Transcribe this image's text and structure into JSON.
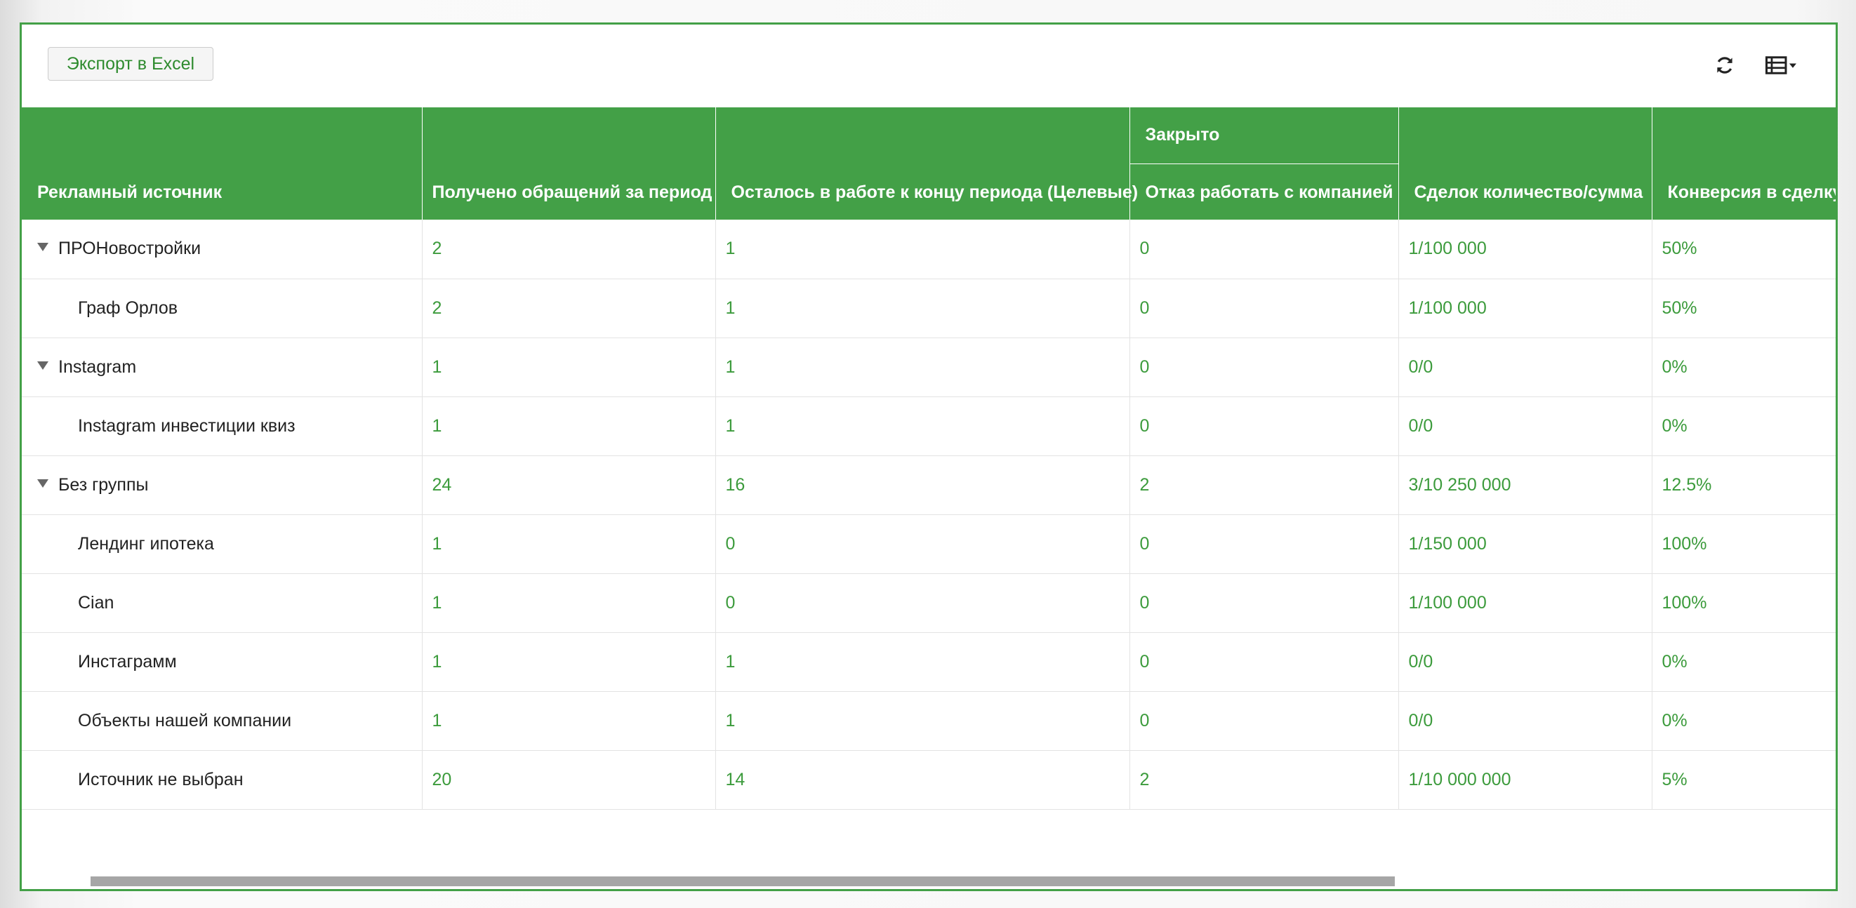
{
  "toolbar": {
    "export_label": "Экспорт в Excel",
    "refresh_icon": "refresh-icon",
    "columns_icon": "table-columns-dropdown-icon"
  },
  "colors": {
    "accent": "#43a047",
    "value_text": "#3c9b3c"
  },
  "table": {
    "headers": {
      "source": "Рекламный источник",
      "received": "Получено обращений за период",
      "remaining": "Осталось в работе к концу периода (Целевые)",
      "closed_group": "Закрыто",
      "refused": "Отказ работать с компанией",
      "deals": "Сделок количество/сумма",
      "conversion": "Конверсия в сделку"
    },
    "rows": [
      {
        "source": "ПРОНовостройки",
        "group": true,
        "received": "2",
        "remaining": "1",
        "refused": "0",
        "deals": "1/100 000",
        "conversion": "50%"
      },
      {
        "source": "Граф Орлов",
        "group": false,
        "received": "2",
        "remaining": "1",
        "refused": "0",
        "deals": "1/100 000",
        "conversion": "50%"
      },
      {
        "source": "Instagram",
        "group": true,
        "received": "1",
        "remaining": "1",
        "refused": "0",
        "deals": "0/0",
        "conversion": "0%"
      },
      {
        "source": "Instagram инвестиции квиз",
        "group": false,
        "received": "1",
        "remaining": "1",
        "refused": "0",
        "deals": "0/0",
        "conversion": "0%"
      },
      {
        "source": "Без группы",
        "group": true,
        "received": "24",
        "remaining": "16",
        "refused": "2",
        "deals": "3/10 250 000",
        "conversion": "12.5%"
      },
      {
        "source": "Лендинг ипотека",
        "group": false,
        "received": "1",
        "remaining": "0",
        "refused": "0",
        "deals": "1/150 000",
        "conversion": "100%"
      },
      {
        "source": "Cian",
        "group": false,
        "received": "1",
        "remaining": "0",
        "refused": "0",
        "deals": "1/100 000",
        "conversion": "100%"
      },
      {
        "source": "Инстаграмм",
        "group": false,
        "received": "1",
        "remaining": "1",
        "refused": "0",
        "deals": "0/0",
        "conversion": "0%"
      },
      {
        "source": "Объекты нашей компании",
        "group": false,
        "received": "1",
        "remaining": "1",
        "refused": "0",
        "deals": "0/0",
        "conversion": "0%"
      },
      {
        "source": "Источник не выбран",
        "group": false,
        "received": "20",
        "remaining": "14",
        "refused": "2",
        "deals": "1/10 000 000",
        "conversion": "5%"
      }
    ]
  },
  "scrollbar": {
    "horizontal_position_fraction": 0.0,
    "visible_fraction": 0.72
  }
}
